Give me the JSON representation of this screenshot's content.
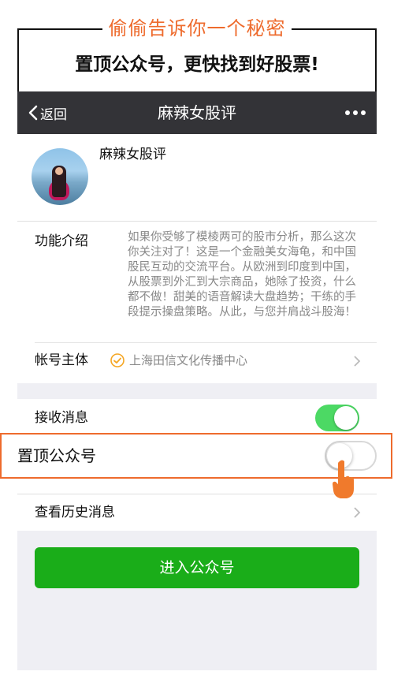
{
  "banner": {
    "secret": "偷偷告诉你一个秘密",
    "headline": "置顶公众号，更快找到好股票!"
  },
  "navbar": {
    "back_label": "返回",
    "title": "麻辣女股评"
  },
  "profile": {
    "name": "麻辣女股评"
  },
  "info": {
    "intro_label": "功能介绍",
    "intro_text": "如果你受够了模棱两可的股市分析，那么这次你关注对了！这是一个金融美女海龟，和中国股民互动的交流平台。从欧洲到印度到中国，从股票到外汇到大宗商品，她除了投资，什么都不做！甜美的语音解读大盘趋势；干练的手段提示操盘策略。从此，与您并肩战斗股海！",
    "owner_label": "帐号主体",
    "owner_value": "上海田信文化传播中心"
  },
  "settings": {
    "receive_label": "接收消息",
    "receive_on": true,
    "pin_label": "置顶公众号",
    "pin_on": false,
    "history_label": "查看历史消息"
  },
  "actions": {
    "enter_label": "进入公众号"
  },
  "colors": {
    "accent_orange": "#ee6b2d",
    "nav_bg": "#333337",
    "toggle_green": "#4cd964",
    "button_green": "#1aad19",
    "verified_orange": "#f5a623"
  },
  "icons": [
    "chevron-left-icon",
    "more-icon",
    "verified-icon",
    "chevron-right-icon",
    "hand-pointer-icon"
  ]
}
